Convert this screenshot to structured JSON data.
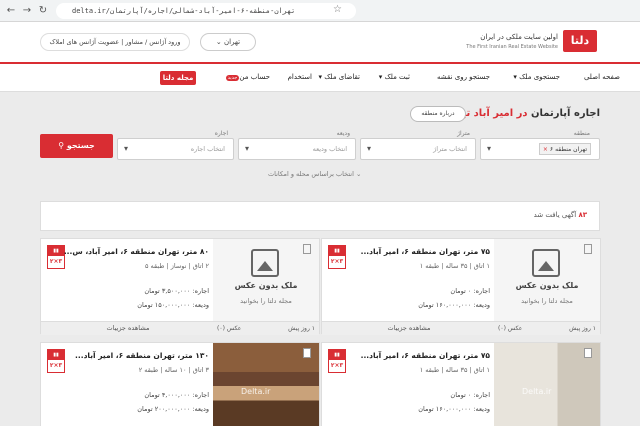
{
  "browser": {
    "url": "delta.ir/تهران-منطقه-۶-امیر-آباد-شمالی/اجاره/آپارتمان"
  },
  "header": {
    "logo_text": "دلتا",
    "tagline": "اولین سایت ملکی در ایران",
    "tagline_en": "The First Iranian Real Estate Website",
    "city_select": "تهران",
    "login_text": "ورود آژانس / مشاور | عضویت آژانس های املاک"
  },
  "nav": {
    "items": [
      "صفحه اصلی",
      "جستجوی ملک",
      "جستجو روی نقشه",
      "ثبت ملک",
      "تقاضای ملک",
      "استخدام",
      "حساب من"
    ],
    "new_badge": "جدید",
    "magazine": "مجله دلتا"
  },
  "search": {
    "title_prefix": "اجاره آپارتمان",
    "title_highlight": "در امیر آباد تهران",
    "about_button": "درباره منطقه",
    "fields": [
      {
        "label": "منطقه",
        "chip": "تهران منطقه ۶",
        "placeholder": ""
      },
      {
        "label": "متراژ",
        "placeholder": "انتخاب متراژ"
      },
      {
        "label": "ودیعه",
        "placeholder": "انتخاب ودیعه"
      },
      {
        "label": "اجاره",
        "placeholder": "انتخاب اجاره"
      }
    ],
    "button": "جستجو",
    "more_filters": "انتخاب براساس محله و امکانات"
  },
  "results": {
    "count": "۸۳",
    "count_suffix": "آگهی یافت شد"
  },
  "cards": [
    {
      "title": "۷۵ متر، تهران منطقه ۶، امیر آباد...",
      "sub": "۱ اتاق  |  ۳۵ ساله  |  طبقه ۱",
      "rent": "اجاره: ۰ تومان",
      "deposit": "ودیعه: ۱۶۰,۰۰۰,۰۰۰ تومان",
      "details": "مشاهده جزییات",
      "no_image_title": "ملک بدون عکس",
      "no_image_sub": "مجله دلتا را بخوانید",
      "date": "۱ روز پیش",
      "photos": "عکس (۰)",
      "badge": "۲×۳"
    },
    {
      "title": "۸۰ متر، تهران منطقه ۶، امیر آباد، س...",
      "sub": "۲ اتاق  |  نوساز  |  طبقه ۵",
      "rent": "اجاره: ۳,۵۰۰,۰۰۰ تومان",
      "deposit": "ودیعه: ۱۵۰,۰۰۰,۰۰۰ تومان",
      "details": "مشاهده جزییات",
      "no_image_title": "ملک بدون عکس",
      "no_image_sub": "مجله دلتا را بخوانید",
      "date": "۱ روز پیش",
      "photos": "عکس (۰)",
      "badge": "۲×۳"
    },
    {
      "title": "۷۵ متر، تهران منطقه ۶، امیر آباد...",
      "sub": "۱ اتاق  |  ۳۵ ساله  |  طبقه ۱",
      "rent": "اجاره: ۰ تومان",
      "deposit": "ودیعه: ۱۶۰,۰۰۰,۰۰۰ تومان",
      "watermark": "Delta.ir",
      "badge": "۲×۳"
    },
    {
      "title": "۱۳۰ متر، تهران منطقه ۶، امیر آباد...",
      "sub": "۳ اتاق  |  ۱۰ ساله  |  طبقه ۲",
      "rent": "اجاره: ۴,۰۰۰,۰۰۰ تومان",
      "deposit": "ودیعه: ۲۰۰,۰۰۰,۰۰۰ تومان",
      "watermark": "Delta.ir",
      "badge": "۲×۳"
    }
  ]
}
